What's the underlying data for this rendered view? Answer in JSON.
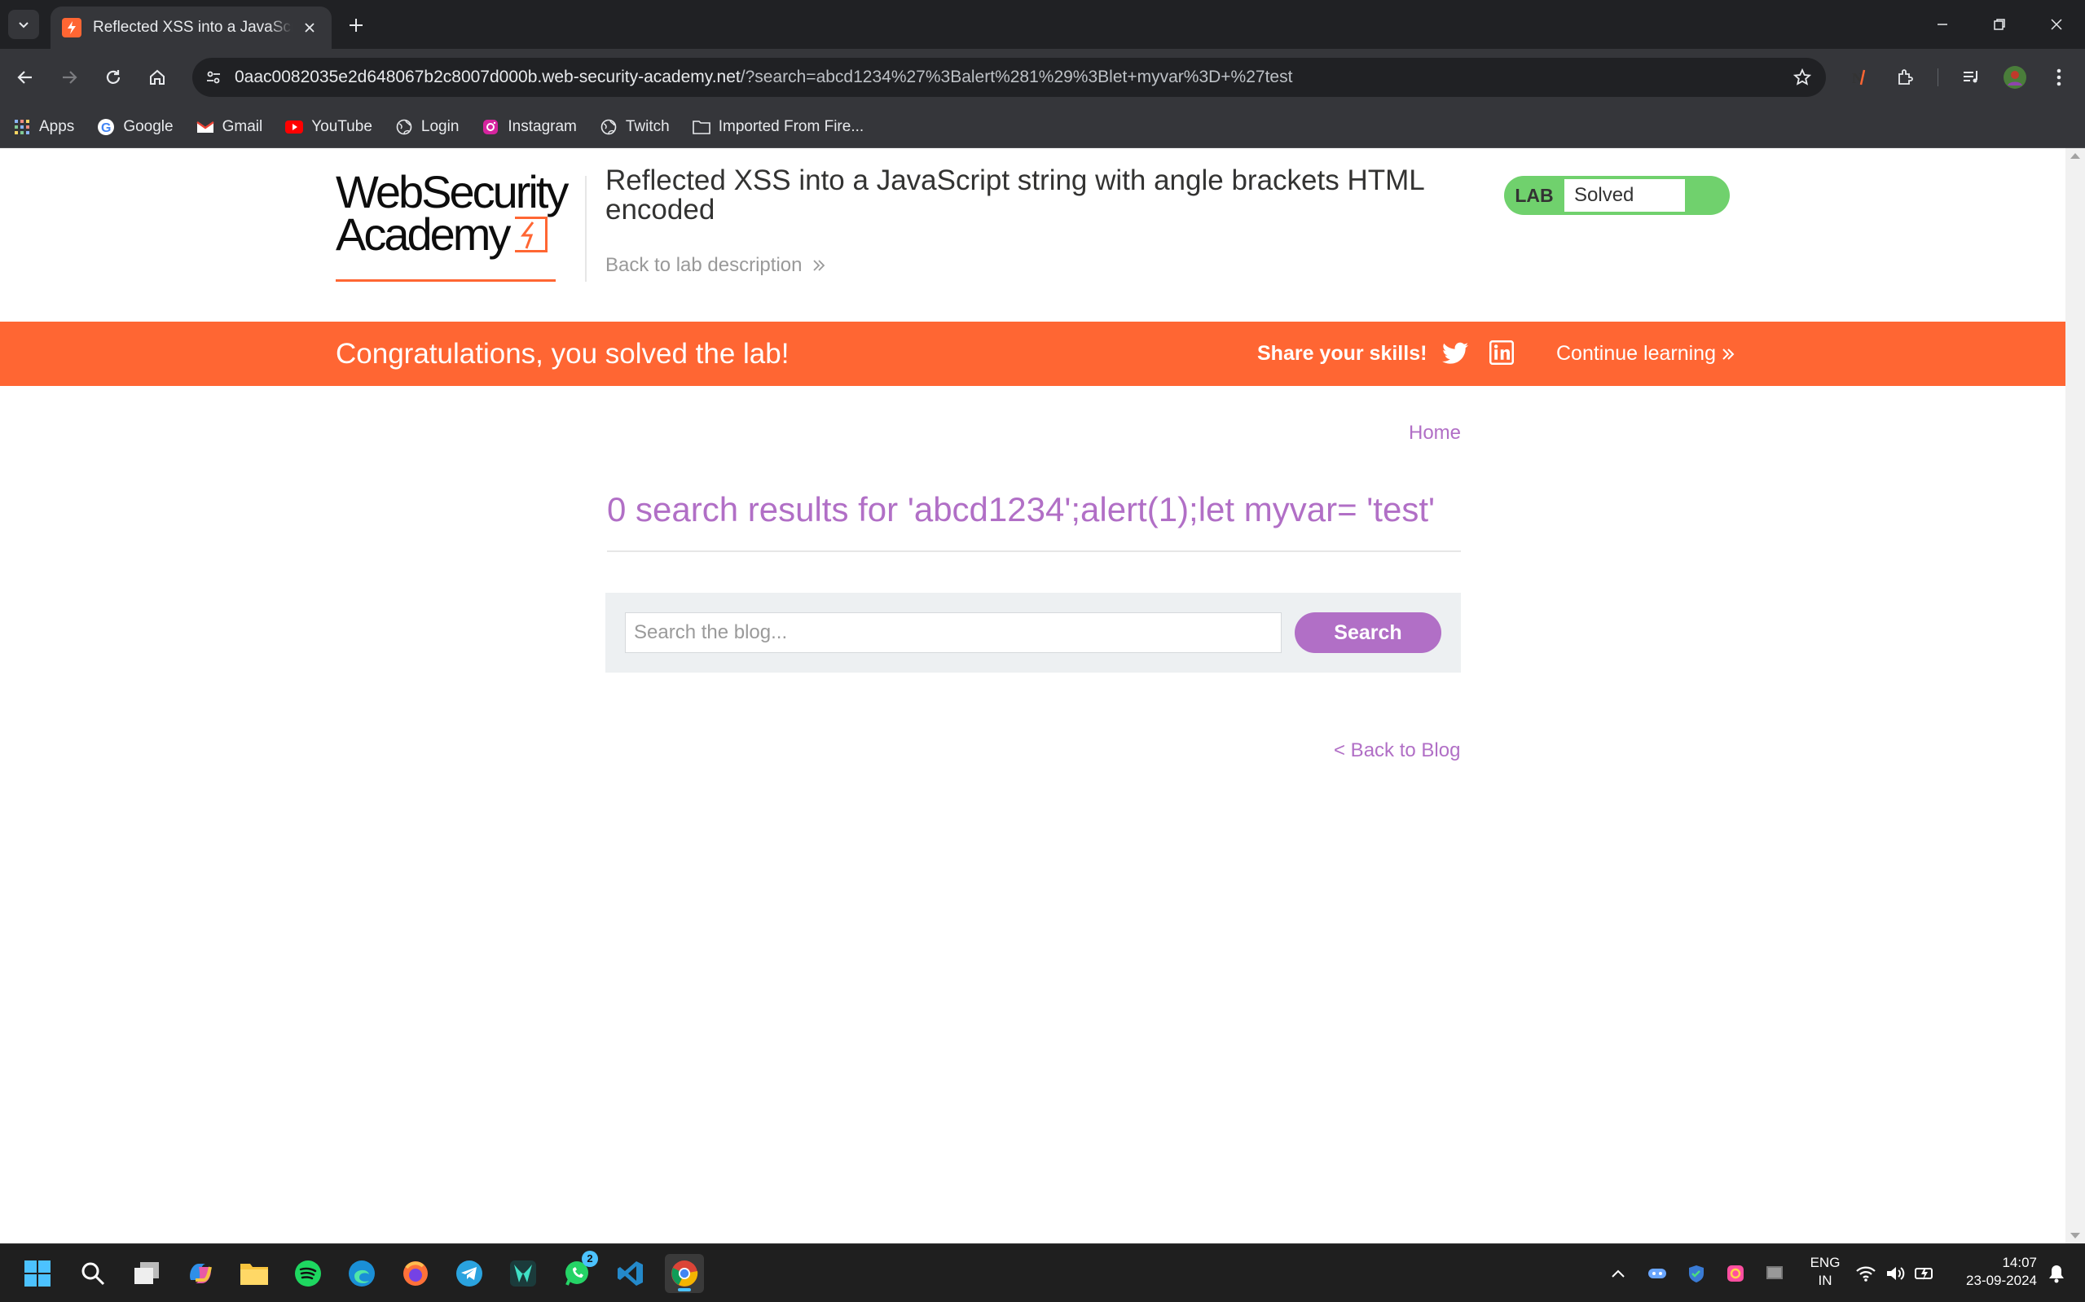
{
  "browser": {
    "tab_title": "Reflected XSS into a JavaScript string with angle brackets HTML encoded",
    "url_host": "0aac0082035e2d648067b2c8007d000b.web-security-academy.net",
    "url_path": "/?search=abcd1234%27%3Balert%281%29%3Blet+myvar%3D+%27test",
    "bookmarks": [
      {
        "label": "Apps",
        "icon": "apps-grid-icon"
      },
      {
        "label": "Google",
        "icon": "google-icon"
      },
      {
        "label": "Gmail",
        "icon": "gmail-icon"
      },
      {
        "label": "YouTube",
        "icon": "youtube-icon"
      },
      {
        "label": "Login",
        "icon": "globe-icon"
      },
      {
        "label": "Instagram",
        "icon": "instagram-icon"
      },
      {
        "label": "Twitch",
        "icon": "globe-icon"
      },
      {
        "label": "Imported From Fire...",
        "icon": "folder-icon"
      }
    ]
  },
  "header": {
    "logo_line1": "WebSecurity",
    "logo_line2": "Academy",
    "lab_title": "Reflected XSS into a JavaScript string with angle brackets HTML encoded",
    "back_to_description": "Back to lab description",
    "lab_badge": "LAB",
    "lab_status": "Solved"
  },
  "banner": {
    "congrats": "Congratulations, you solved the lab!",
    "share": "Share your skills!",
    "continue": "Continue learning"
  },
  "main": {
    "home_link": "Home",
    "results_heading": "0 search results for 'abcd1234';alert(1);let myvar= 'test'",
    "search_placeholder": "Search the blog...",
    "search_button": "Search",
    "back_to_blog": "< Back to Blog"
  },
  "taskbar": {
    "lang_line1": "ENG",
    "lang_line2": "IN",
    "time": "14:07",
    "date": "23-09-2024",
    "whatsapp_badge": "2"
  },
  "colors": {
    "accent_orange": "#ff6633",
    "link_purple": "#b16fc6",
    "solved_green": "#70d16d"
  }
}
